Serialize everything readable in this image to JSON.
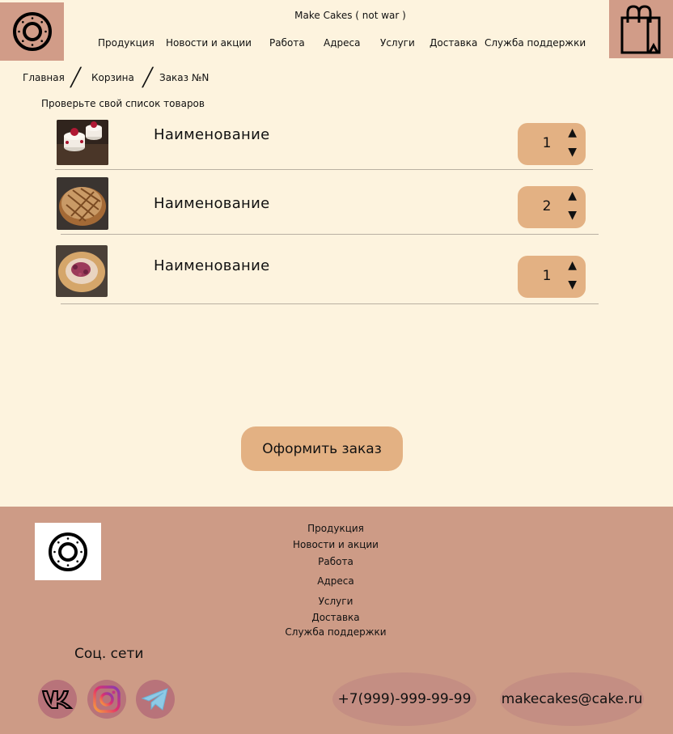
{
  "header": {
    "title": "Make Cakes ( not war )",
    "nav": [
      "Продукция",
      "Новости и акции",
      "Работа",
      "Адреса",
      "Услуги",
      "Доставка",
      "Служба поддержки"
    ]
  },
  "breadcrumb": [
    "Главная",
    "Корзина",
    "Заказ №N"
  ],
  "cart": {
    "subtitle": "Проверьте свой список товаров",
    "items": [
      {
        "name": "Наименование",
        "qty": "1",
        "image": "raspberry-tartlets"
      },
      {
        "name": "Наименование",
        "qty": "2",
        "image": "bread-loaf"
      },
      {
        "name": "Наименование",
        "qty": "1",
        "image": "berry-galette"
      }
    ],
    "up_arrow": "▲",
    "down_arrow": "▼"
  },
  "order_button": "Оформить заказ",
  "footer": {
    "nav": [
      "Продукция",
      "Новости и акции",
      "Работа",
      "Адреса",
      "Услуги",
      "Доставка",
      "Служба поддержки"
    ],
    "social_title": "Соц. сети",
    "social": [
      "vk-icon",
      "instagram-icon",
      "telegram-icon"
    ],
    "phone": "+7(999)-999-99-99",
    "email": "makecakes@cake.ru"
  },
  "colors": {
    "background": "#fdf3de",
    "accent": "#d19c88",
    "button": "#e3b183",
    "footer": "#cd9b86"
  }
}
